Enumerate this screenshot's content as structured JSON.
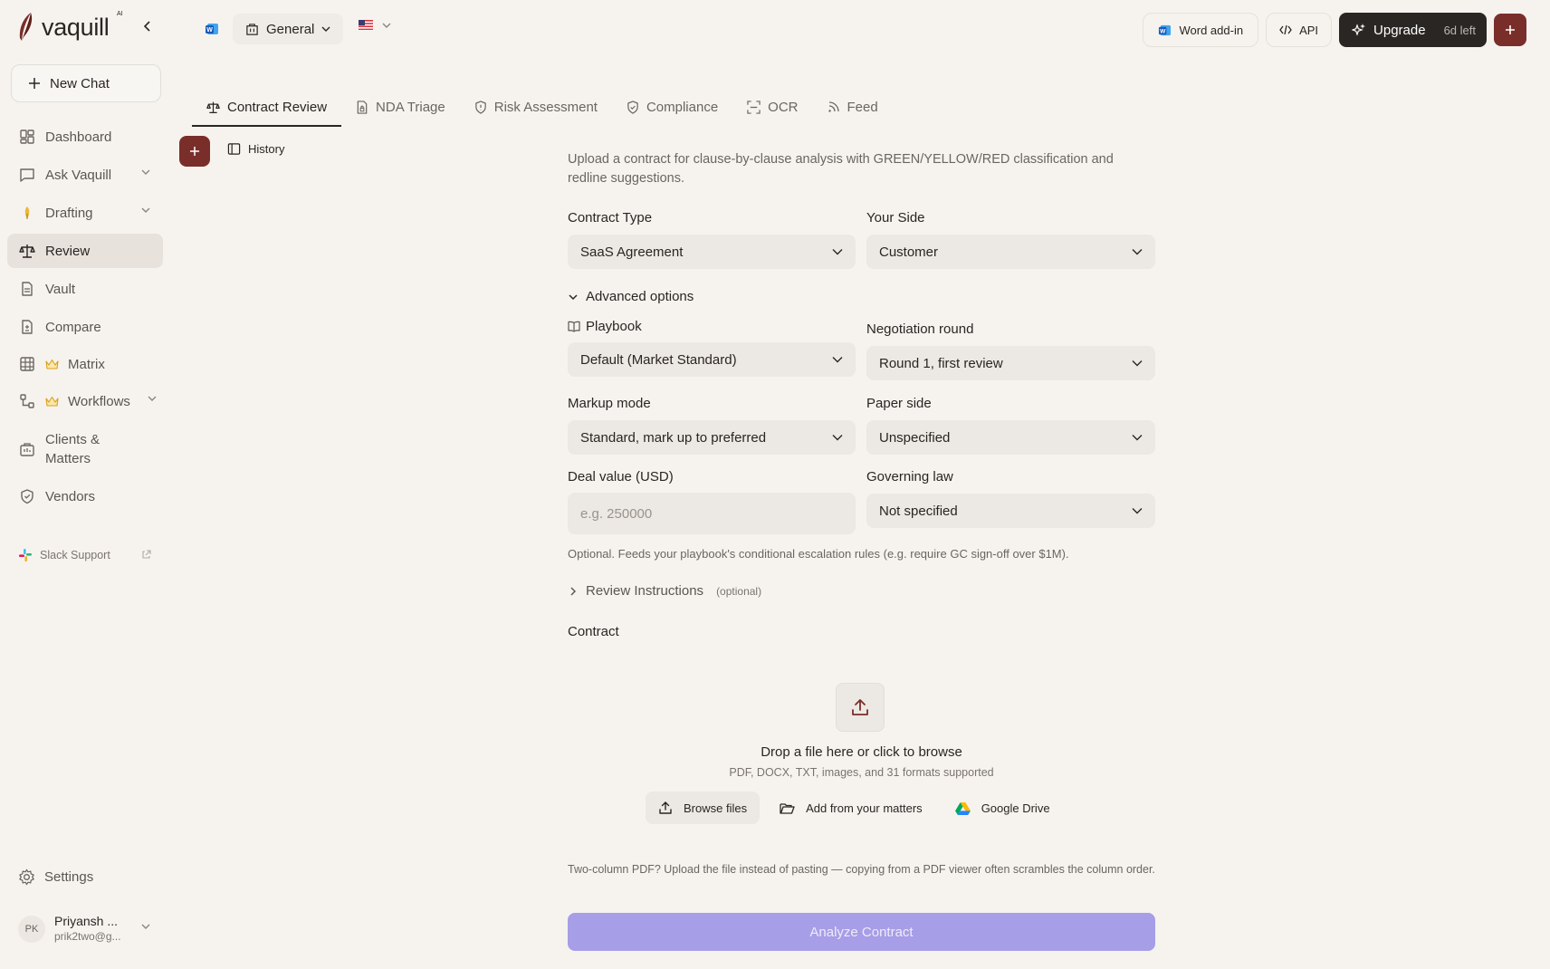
{
  "brand": {
    "name": "vaquill",
    "superscript": "AI"
  },
  "sidebar": {
    "new_chat": "New Chat",
    "items": [
      {
        "label": "Dashboard",
        "icon": "dashboard-icon"
      },
      {
        "label": "Ask Vaquill",
        "icon": "chat-icon",
        "expandable": true
      },
      {
        "label": "Drafting",
        "icon": "pen-nib-icon",
        "expandable": true
      },
      {
        "label": "Review",
        "icon": "scale-icon",
        "active": true
      },
      {
        "label": "Vault",
        "icon": "file-icon"
      },
      {
        "label": "Compare",
        "icon": "compare-icon"
      },
      {
        "label": "Matrix",
        "icon": "grid-icon",
        "premium": true
      },
      {
        "label": "Workflows",
        "icon": "workflow-icon",
        "premium": true,
        "expandable": true
      },
      {
        "label": "Clients & Matters",
        "icon": "briefcase-icon"
      },
      {
        "label": "Vendors",
        "icon": "shield-icon"
      }
    ],
    "slack_support": "Slack Support",
    "settings": "Settings",
    "user": {
      "initials": "PK",
      "name": "Priyansh ...",
      "email": "prik2two@g..."
    }
  },
  "topbar": {
    "workspace": "General",
    "word_addin": "Word add-in",
    "api": "API",
    "upgrade": "Upgrade",
    "days_left": "6d left"
  },
  "tabs": [
    {
      "label": "Contract Review",
      "icon": "scale-icon",
      "active": true
    },
    {
      "label": "NDA Triage",
      "icon": "document-lock-icon"
    },
    {
      "label": "Risk Assessment",
      "icon": "shield-alert-icon"
    },
    {
      "label": "Compliance",
      "icon": "shield-check-icon"
    },
    {
      "label": "OCR",
      "icon": "scan-icon"
    },
    {
      "label": "Feed",
      "icon": "rss-icon"
    }
  ],
  "history_label": "History",
  "form": {
    "intro": "Upload a contract for clause-by-clause analysis with GREEN/YELLOW/RED classification and redline suggestions.",
    "contract_type": {
      "label": "Contract Type",
      "value": "SaaS Agreement"
    },
    "your_side": {
      "label": "Your Side",
      "value": "Customer"
    },
    "advanced_options": "Advanced options",
    "playbook": {
      "label": "Playbook",
      "value": "Default (Market Standard)"
    },
    "negotiation_round": {
      "label": "Negotiation round",
      "value": "Round 1, first review"
    },
    "markup_mode": {
      "label": "Markup mode",
      "value": "Standard, mark up to preferred"
    },
    "paper_side": {
      "label": "Paper side",
      "value": "Unspecified"
    },
    "deal_value": {
      "label": "Deal value (USD)",
      "placeholder": "e.g. 250000"
    },
    "governing_law": {
      "label": "Governing law",
      "value": "Not specified"
    },
    "deal_helper": "Optional. Feeds your playbook's conditional escalation rules (e.g. require GC sign-off over $1M).",
    "review_instructions": "Review Instructions",
    "optional": "(optional)",
    "contract_label": "Contract",
    "drop_title": "Drop a file here or click to browse",
    "drop_sub": "PDF, DOCX, TXT, images, and 31 formats supported",
    "browse_files": "Browse files",
    "add_from_matters": "Add from your matters",
    "google_drive": "Google Drive",
    "note": "Two-column PDF? Upload the file instead of pasting — copying from a PDF viewer often scrambles the column order.",
    "analyze": "Analyze Contract"
  },
  "colors": {
    "accent": "#7a2e2a",
    "dark": "#2a2624",
    "analyze": "#a69ee6",
    "background": "#f6f3ef"
  }
}
